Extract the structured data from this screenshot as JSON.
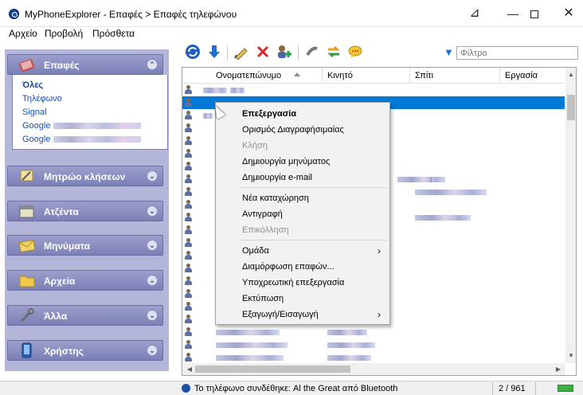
{
  "window": {
    "title": "MyPhoneExplorer -  Επαφές > Επαφές τηλεφώνου",
    "controls": {
      "pin": "⊿",
      "minimize": "—",
      "close": "✕"
    }
  },
  "menubar": [
    "Αρχείο",
    "Προβολή",
    "Πρόσθετα"
  ],
  "sidebar": {
    "sections": [
      {
        "label": "Επαφές",
        "icon": "contacts-book-icon",
        "expanded": true
      },
      {
        "label": "Μητρώο κλήσεων",
        "icon": "call-log-icon",
        "expanded": false
      },
      {
        "label": "Ατζέντα",
        "icon": "calendar-icon",
        "expanded": false
      },
      {
        "label": "Μηνύματα",
        "icon": "envelope-icon",
        "expanded": false
      },
      {
        "label": "Αρχεία",
        "icon": "folder-icon",
        "expanded": false
      },
      {
        "label": "Άλλα",
        "icon": "tools-icon",
        "expanded": false
      },
      {
        "label": "Χρήστης",
        "icon": "phone-icon",
        "expanded": false
      }
    ],
    "contact_groups": [
      "Όλες",
      "Τηλέφωνο",
      "Signal",
      "Google",
      "Google"
    ],
    "chevron_up": "⌃",
    "chevron_down": "⌄"
  },
  "toolbar": {
    "buttons": [
      "refresh-icon",
      "download-icon",
      "edit-icon",
      "delete-icon",
      "add-contact-icon",
      "call-icon",
      "sync-icon",
      "message-icon"
    ],
    "filter_placeholder": "Φίλτρο"
  },
  "grid": {
    "columns": [
      "Ονοματεπώνυμο",
      "Κινητό",
      "Σπίτι",
      "Εργασία"
    ],
    "sorted_column": "Ονοματεπώνυμο"
  },
  "context_menu": {
    "items": [
      {
        "label": "Επεξεργασία",
        "bold": true,
        "disabled": false,
        "submenu": false
      },
      {
        "label": "Ορισμός Διαγραφήσιμαίας",
        "bold": false,
        "disabled": false,
        "submenu": false
      },
      {
        "label": "Κλήση",
        "bold": false,
        "disabled": true,
        "submenu": false
      },
      {
        "label": "Δημιουργία μηνύματος",
        "bold": false,
        "disabled": false,
        "submenu": false
      },
      {
        "label": "Δημιουργία e-mail",
        "bold": false,
        "disabled": false,
        "submenu": false
      },
      {
        "label": "Νέα καταχώρηση",
        "bold": false,
        "disabled": false,
        "submenu": false
      },
      {
        "label": "Αντιγραφή",
        "bold": false,
        "disabled": false,
        "submenu": false
      },
      {
        "label": "Επικόλληση",
        "bold": false,
        "disabled": true,
        "submenu": false
      },
      {
        "label": "Ομάδα",
        "bold": false,
        "disabled": false,
        "submenu": true
      },
      {
        "label": "Διαμόρφωση επαφών...",
        "bold": false,
        "disabled": false,
        "submenu": false
      },
      {
        "label": "Υποχρεωτική επεξεργασία",
        "bold": false,
        "disabled": false,
        "submenu": false
      },
      {
        "label": "Εκτύπωση",
        "bold": false,
        "disabled": false,
        "submenu": false
      },
      {
        "label": "Εξαγωγή/Εισαγωγή",
        "bold": false,
        "disabled": false,
        "submenu": true
      }
    ],
    "submenu_arrow": "›"
  },
  "statusbar": {
    "connection": "Το τηλέφωνο συνδέθηκε: Al the Great από Bluetooth",
    "count": "2 / 961"
  },
  "colors": {
    "accent": "#0078d7",
    "sidebar_bg": "#b4b6d9",
    "sidebar_header": "#7c80b6",
    "link": "#1750b8"
  }
}
